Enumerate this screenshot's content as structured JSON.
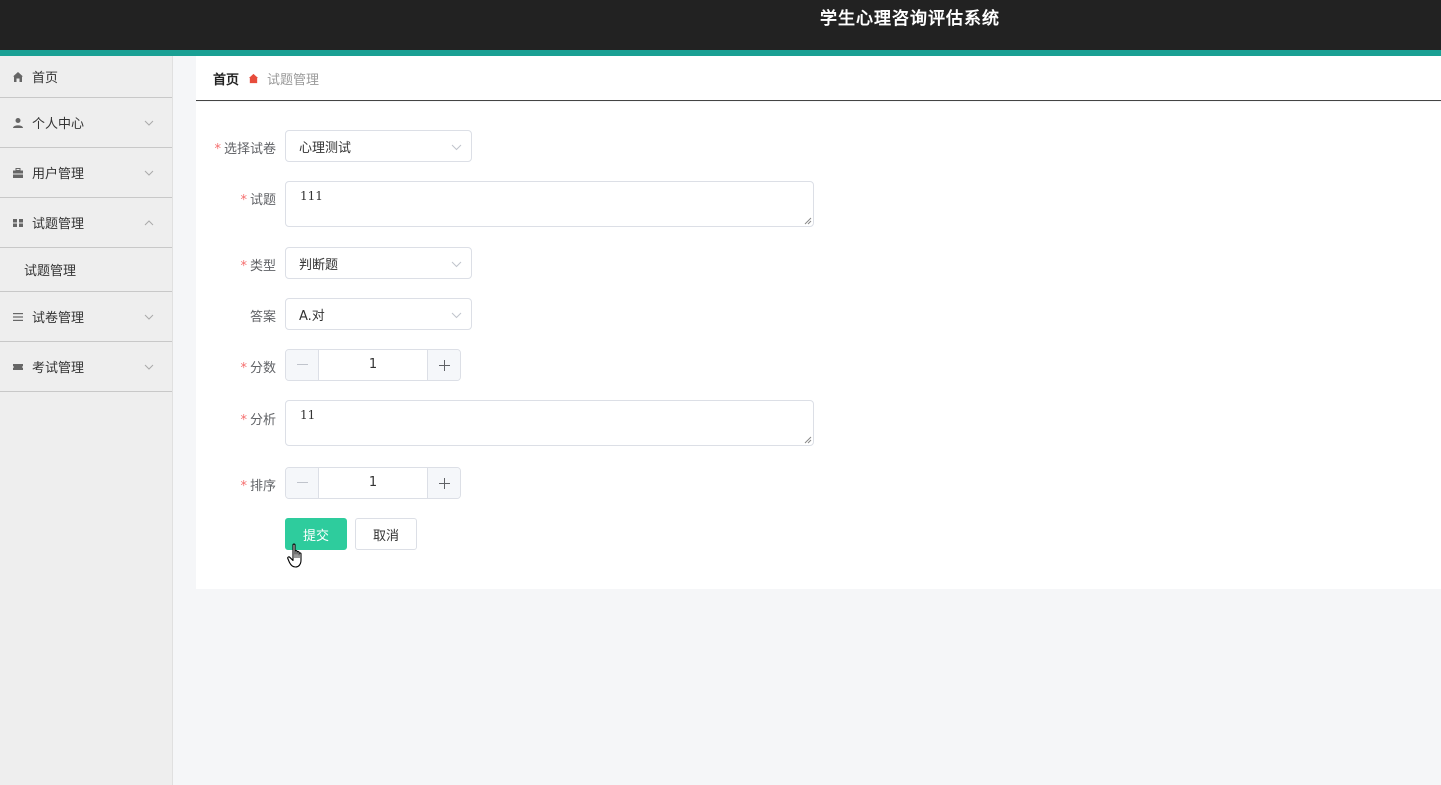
{
  "app": {
    "title": "学生心理咨询评估系统"
  },
  "sidebar": {
    "items": [
      {
        "label": "首页",
        "icon": "home-icon"
      },
      {
        "label": "个人中心",
        "icon": "user-icon",
        "expanded": false
      },
      {
        "label": "用户管理",
        "icon": "briefcase-icon",
        "expanded": false
      },
      {
        "label": "试题管理",
        "icon": "grid-icon",
        "expanded": true,
        "children": [
          {
            "label": "试题管理"
          }
        ]
      },
      {
        "label": "试卷管理",
        "icon": "list-icon",
        "expanded": false
      },
      {
        "label": "考试管理",
        "icon": "ticket-icon",
        "expanded": false
      }
    ]
  },
  "breadcrumb": {
    "home": "首页",
    "current": "试题管理"
  },
  "form": {
    "paper": {
      "label": "选择试卷",
      "value": "心理测试",
      "required": true
    },
    "question": {
      "label": "试题",
      "value": "111",
      "required": true
    },
    "type": {
      "label": "类型",
      "value": "判断题",
      "required": true
    },
    "answer": {
      "label": "答案",
      "value": "A.对",
      "required": false
    },
    "score": {
      "label": "分数",
      "value": "1",
      "required": true
    },
    "analysis": {
      "label": "分析",
      "value": "11",
      "required": true
    },
    "order": {
      "label": "排序",
      "value": "1",
      "required": true
    },
    "submit_label": "提交",
    "cancel_label": "取消"
  },
  "colors": {
    "header_bg": "#222222",
    "header_accent": "#1aa094",
    "primary": "#2ecc9d",
    "required": "#f56c6c"
  }
}
